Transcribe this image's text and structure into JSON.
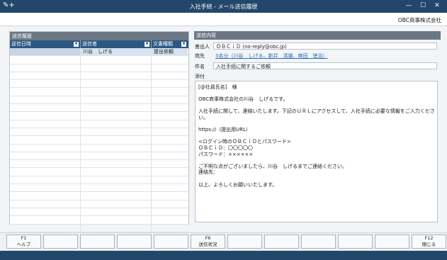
{
  "window": {
    "title": "入社手続 - メール送信履歴",
    "controls": [
      "—",
      "☐",
      "✕"
    ]
  },
  "company": "OBC商事株式会社",
  "left_panel": {
    "title": "送信履歴",
    "columns": [
      "送信日時",
      "送信者",
      "文書種類"
    ],
    "rows": [
      [
        "",
        "川谷　しげる",
        "提出依頼"
      ]
    ]
  },
  "right_panel": {
    "title": "送信内容",
    "sender_label": "差出人",
    "sender_value": "ＯＢＣｉＤ (no-reply@obc.jp)",
    "to_label": "宛先",
    "to_value": "3名分（川谷　しげる、新井　清雄、麻田　徳治）",
    "subject_label": "件名",
    "subject_value": "入社手続に関するご依頼",
    "attach_label": "添付",
    "body": "[@社員氏名]　様\n\nOBC商事株式会社の川谷　しげるです。\n\n入社手続に関して、連絡いたします。下記のＵＲＬにアクセスして、入社手続に必要な情報をご入力ください。\n\nhttps://（提出用URL）\n\n<ログイン時のＯＢＣｉＤとパスワード>\nＯＢＣｉＤ：〇〇〇〇〇\nパスワード：××××××\n\nご不明な点がございましたら、川谷　しげるまでご連絡ください。\n連絡先：\n\n以上、よろしくお願いいたします。"
  },
  "function_keys": [
    {
      "key": "F1",
      "label": "ヘルプ"
    },
    {
      "key": "",
      "label": ""
    },
    {
      "key": "",
      "label": ""
    },
    {
      "key": "",
      "label": ""
    },
    {
      "key": "",
      "label": ""
    },
    {
      "key": "F6",
      "label": "送信状況"
    },
    {
      "key": "",
      "label": ""
    },
    {
      "key": "",
      "label": ""
    },
    {
      "key": "",
      "label": ""
    },
    {
      "key": "",
      "label": ""
    },
    {
      "key": "",
      "label": ""
    },
    {
      "key": "F12",
      "label": "閉じる"
    }
  ]
}
